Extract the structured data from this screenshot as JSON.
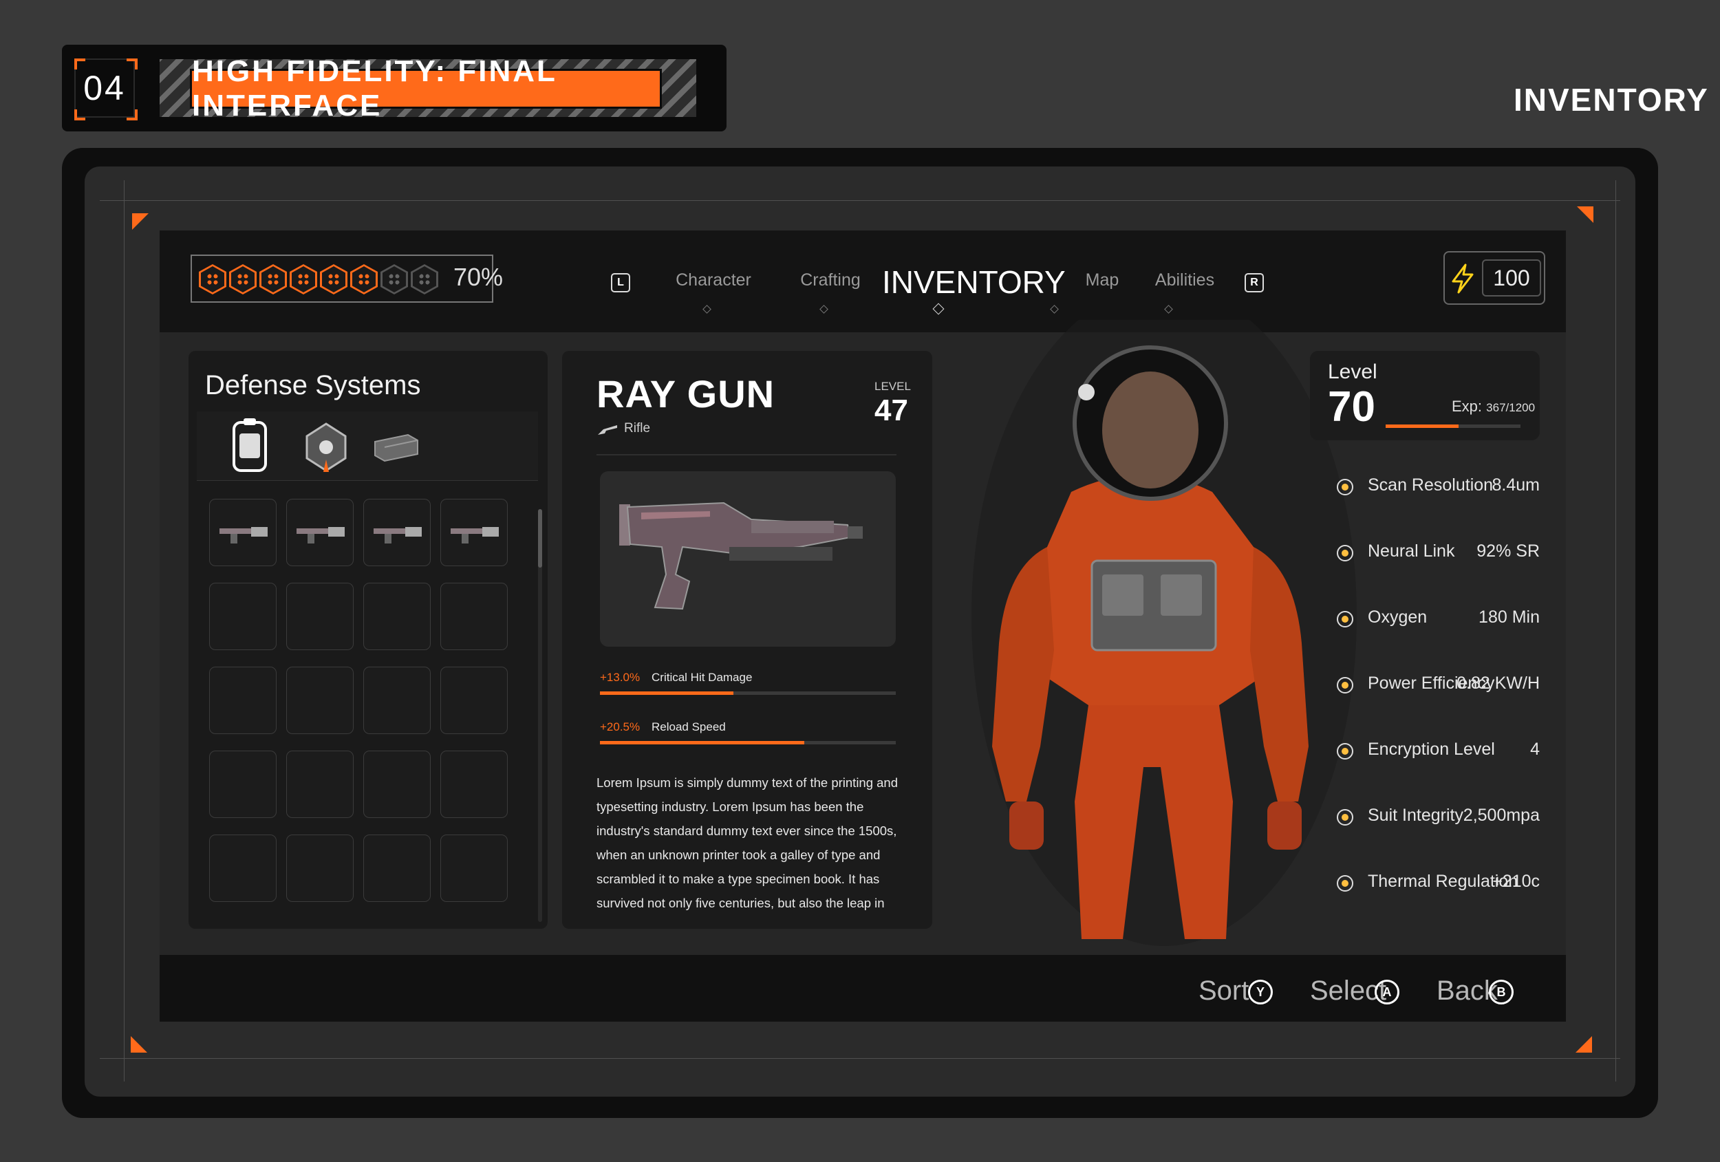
{
  "header": {
    "number": "04",
    "title": "HIGH FIDELITY: FINAL INTERFACE",
    "page_heading": "INVENTORY"
  },
  "colors": {
    "accent": "#ff6a1a",
    "background": "#393939",
    "panel": "#1b1b1b"
  },
  "hud": {
    "health_percent_label": "70%",
    "health_cells_filled": 6,
    "health_cells_total": 8,
    "energy_value": "100",
    "energy_icon": "lightning-bolt-icon"
  },
  "nav": {
    "left_key": "L",
    "right_key": "R",
    "tabs": [
      {
        "label": "Character",
        "active": false
      },
      {
        "label": "Crafting",
        "active": false
      },
      {
        "label": "INVENTORY",
        "active": true
      },
      {
        "label": "Map",
        "active": false
      },
      {
        "label": "Abilities",
        "active": false
      }
    ]
  },
  "defense": {
    "title": "Defense Systems",
    "category_icons": [
      "backpack-icon",
      "mine-icon",
      "crate-icon"
    ],
    "rows": 5,
    "cols": 4,
    "filled_slots": [
      "pistol-icon",
      "rifle-icon",
      "minigun-icon",
      "launcher-icon"
    ]
  },
  "item": {
    "name": "RAY GUN",
    "type": "Rifle",
    "level_label": "LEVEL",
    "level_value": "47",
    "stats": [
      {
        "pct": "+13.0%",
        "name": "Critical Hit Damage",
        "fill": 0.45
      },
      {
        "pct": "+20.5%",
        "name": "Reload Speed",
        "fill": 0.69
      }
    ],
    "description": "Lorem Ipsum is simply dummy text of the printing and typesetting industry. Lorem Ipsum has been the industry's standard dummy text ever since the 1500s, when an unknown printer took a galley of type and scrambled it to make a type specimen book. It has survived not only five centuries, but also the leap in"
  },
  "character": {
    "level_label": "Level",
    "level_value": "70",
    "exp_label": "Exp:",
    "exp_value": "367/1200",
    "exp_fill": 0.54,
    "stats": [
      {
        "icon": "scan-icon",
        "name": "Scan Resolution",
        "value": "8.4um"
      },
      {
        "icon": "neural-icon",
        "name": "Neural Link",
        "value": "92% SR"
      },
      {
        "icon": "oxygen-icon",
        "name": "Oxygen",
        "value": "180 Min"
      },
      {
        "icon": "power-icon",
        "name": "Power Efficiency",
        "value": "0.82 KW/H"
      },
      {
        "icon": "encryption-icon",
        "name": "Encryption Level",
        "value": "4"
      },
      {
        "icon": "helmet-icon",
        "name": "Suit Integrity",
        "value": "2,500mpa"
      },
      {
        "icon": "thermal-icon",
        "name": "Thermal Regulation",
        "value": "+210c"
      }
    ]
  },
  "footer": {
    "buttons": [
      {
        "label": "Sort",
        "key": "Y"
      },
      {
        "label": "Select",
        "key": "A"
      },
      {
        "label": "Back",
        "key": "B"
      }
    ]
  }
}
